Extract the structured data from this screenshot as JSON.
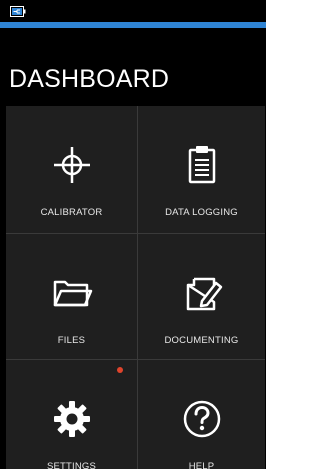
{
  "app": {
    "title": "DASHBOARD",
    "accent_color": "#2f84d4",
    "background_color": "#000000",
    "tile_color": "#1f1f1f",
    "notification_color": "#e0442c"
  },
  "status_bar": {
    "icons": [
      "battery-plug-icon"
    ]
  },
  "tiles": [
    {
      "label": "CALIBRATOR",
      "icon": "crosshair-icon"
    },
    {
      "label": "DATA LOGGING",
      "icon": "clipboard-icon"
    },
    {
      "label": "FILES",
      "icon": "folder-icon"
    },
    {
      "label": "DOCUMENTING",
      "icon": "document-pen-icon"
    },
    {
      "label": "SETTINGS",
      "icon": "gear-icon",
      "has_notification": true
    },
    {
      "label": "HELP",
      "icon": "help-icon"
    }
  ]
}
